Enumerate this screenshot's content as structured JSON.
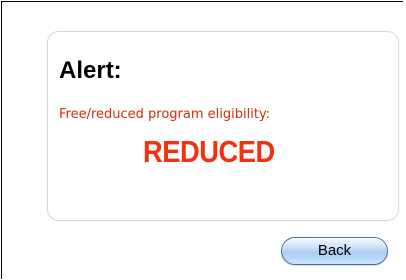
{
  "alert": {
    "title": "Alert:",
    "eligibility_label": "Free/reduced program eligibility:",
    "eligibility_value": "REDUCED"
  },
  "actions": {
    "back_label": "Back"
  },
  "colors": {
    "label_red": "#d52b12",
    "value_red": "#f4310f",
    "button_blue": "#a9cdf3"
  }
}
